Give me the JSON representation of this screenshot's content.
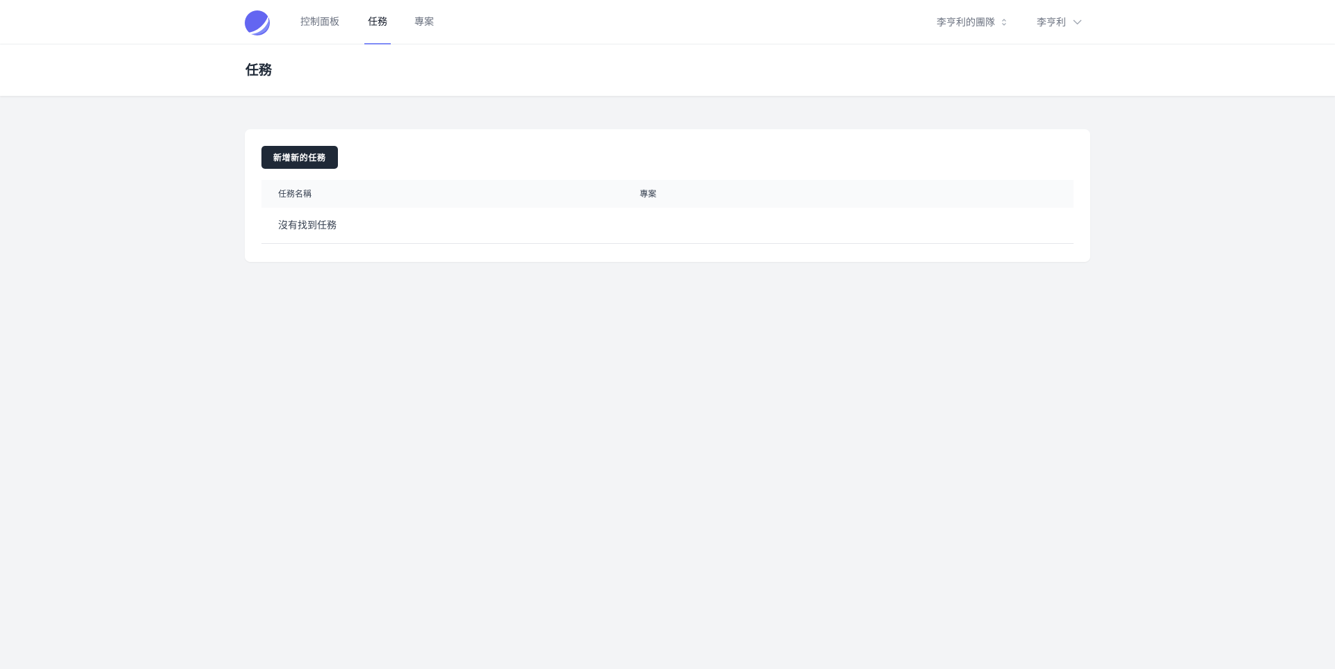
{
  "nav": {
    "links": [
      {
        "label": "控制面板"
      },
      {
        "label": "任務"
      },
      {
        "label": "專案"
      }
    ],
    "team": "李亨利的團隊",
    "user": "李亨利"
  },
  "header": {
    "title": "任務"
  },
  "card": {
    "add_button": "新增新的任務",
    "table": {
      "columns": [
        "任務名稱",
        "專案"
      ],
      "empty_message": "沒有找到任務"
    }
  },
  "colors": {
    "accent": "#6366f1",
    "button": "#1f2937"
  }
}
